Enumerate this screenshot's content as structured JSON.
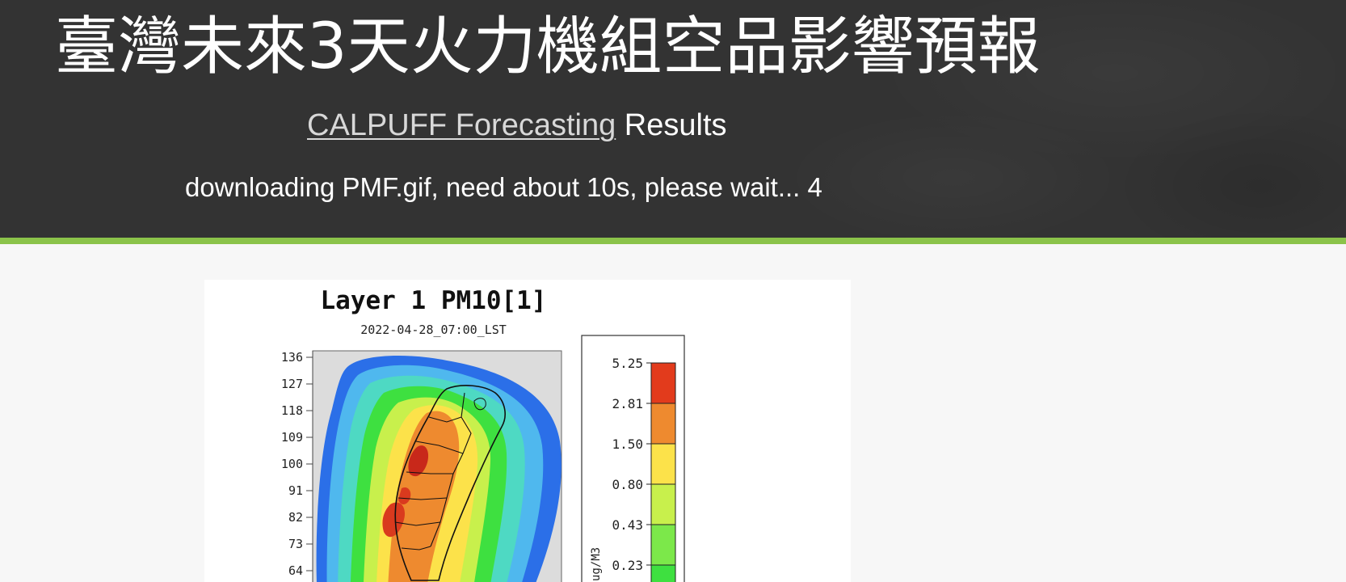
{
  "header": {
    "title": "臺灣未來3天火力機組空品影響預報",
    "subtitle_link": "CALPUFF Forecasting",
    "subtitle_rest": " Results",
    "status": "downloading PMF.gif, need about 10s, please wait... 4"
  },
  "colors": {
    "header_bg": "#333333",
    "accent_bar": "#8bc34a",
    "content_bg": "#f7f7f7"
  },
  "plot": {
    "title": "Layer 1 PM10[1]",
    "timestamp": "2022-04-28_07:00_LST",
    "y_ticks": [
      "136",
      "127",
      "118",
      "109",
      "100",
      "91",
      "82",
      "73",
      "64"
    ],
    "colorbar": {
      "unit": "ug/M3",
      "labels": [
        "5.25",
        "2.81",
        "1.50",
        "0.80",
        "0.43",
        "0.23"
      ],
      "colors": [
        "#e23b1c",
        "#ee8a2f",
        "#fce24a",
        "#c8f04c",
        "#7ce84a",
        "#3ee040"
      ]
    }
  }
}
